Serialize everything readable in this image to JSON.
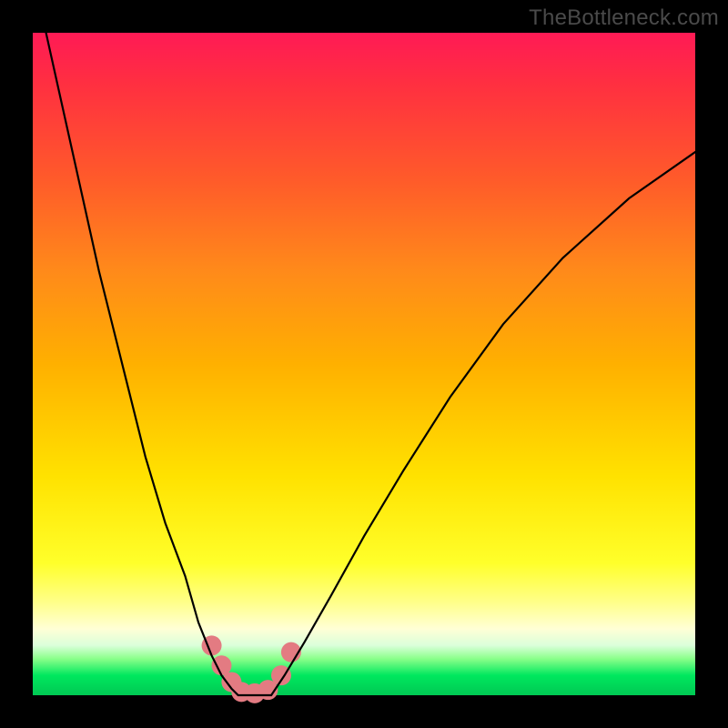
{
  "watermark": "TheBottleneck.com",
  "chart_data": {
    "type": "line",
    "title": "",
    "xlabel": "",
    "ylabel": "",
    "xlim": [
      0,
      100
    ],
    "ylim": [
      0,
      100
    ],
    "grid": false,
    "legend": false,
    "series": [
      {
        "name": "curve-left",
        "x": [
          2,
          6,
          10,
          14,
          17,
          20,
          23,
          25,
          27,
          28.5,
          30,
          31
        ],
        "y": [
          100,
          82,
          64,
          48,
          36,
          26,
          18,
          11,
          6,
          3,
          1,
          0
        ]
      },
      {
        "name": "curve-flat",
        "x": [
          31,
          36
        ],
        "y": [
          0,
          0
        ]
      },
      {
        "name": "curve-right",
        "x": [
          36,
          38,
          41,
          45,
          50,
          56,
          63,
          71,
          80,
          90,
          100
        ],
        "y": [
          0,
          3,
          8,
          15,
          24,
          34,
          45,
          56,
          66,
          75,
          82
        ]
      }
    ],
    "markers": {
      "name": "scatter-markers",
      "points": [
        {
          "x": 27.0,
          "y": 7.5
        },
        {
          "x": 28.5,
          "y": 4.5
        },
        {
          "x": 30.0,
          "y": 2.0
        },
        {
          "x": 31.5,
          "y": 0.5
        },
        {
          "x": 33.5,
          "y": 0.3
        },
        {
          "x": 35.5,
          "y": 0.8
        },
        {
          "x": 37.5,
          "y": 3.0
        },
        {
          "x": 39.0,
          "y": 6.5
        }
      ],
      "color": "#e37b82",
      "radius_px": 11
    },
    "background": "rainbow-vertical-gradient"
  }
}
